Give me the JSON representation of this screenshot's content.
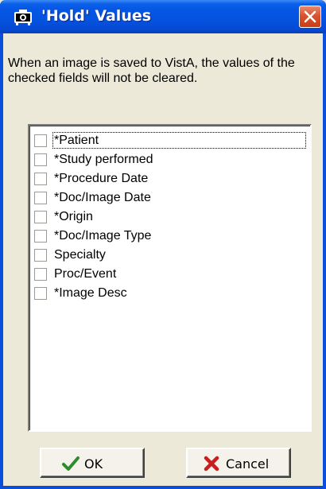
{
  "window": {
    "title": "'Hold' Values"
  },
  "description": "When an image is saved to VistA, the values of the checked fields will not be cleared.",
  "fields": [
    {
      "label": "*Patient",
      "checked": false,
      "focused": true
    },
    {
      "label": "*Study performed",
      "checked": false
    },
    {
      "label": "*Procedure Date",
      "checked": false
    },
    {
      "label": "*Doc/Image Date",
      "checked": false
    },
    {
      "label": "*Origin",
      "checked": false
    },
    {
      "label": "*Doc/Image Type",
      "checked": false
    },
    {
      "label": "Specialty",
      "checked": false
    },
    {
      "label": "Proc/Event",
      "checked": false
    },
    {
      "label": "*Image Desc",
      "checked": false
    }
  ],
  "buttons": {
    "ok_label": "OK",
    "cancel_label": "Cancel"
  },
  "icons": {
    "title": "camera-icon",
    "close": "close-icon",
    "ok": "checkmark-icon",
    "cancel": "x-icon"
  },
  "colors": {
    "titlebar": "#0553e0",
    "close_button": "#d9532f",
    "ok_check": "#2e8b2e",
    "cancel_x": "#c81e1e",
    "dialog_background": "#ece9d8"
  }
}
